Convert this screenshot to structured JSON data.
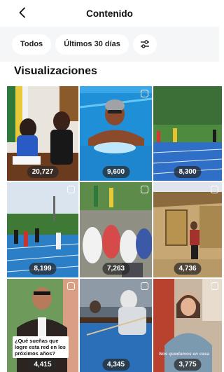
{
  "header": {
    "title": "Contenido",
    "back_icon": "chevron-left-icon"
  },
  "filters": {
    "all_label": "Todos",
    "period_label": "Últimos 30 días",
    "settings_icon": "sliders-icon"
  },
  "section": {
    "title": "Visualizaciones"
  },
  "tiles": [
    {
      "views": "20,727"
    },
    {
      "views": "9,600"
    },
    {
      "views": "8,300"
    },
    {
      "views": "8,199"
    },
    {
      "views": "7,263"
    },
    {
      "views": "4,736"
    },
    {
      "views": "4,415",
      "caption": "¿Qué sueñas que logre esta red en los próximos años?"
    },
    {
      "views": "4,345"
    },
    {
      "views": "3,775",
      "overlay": "Nos quedamos en casa"
    }
  ]
}
